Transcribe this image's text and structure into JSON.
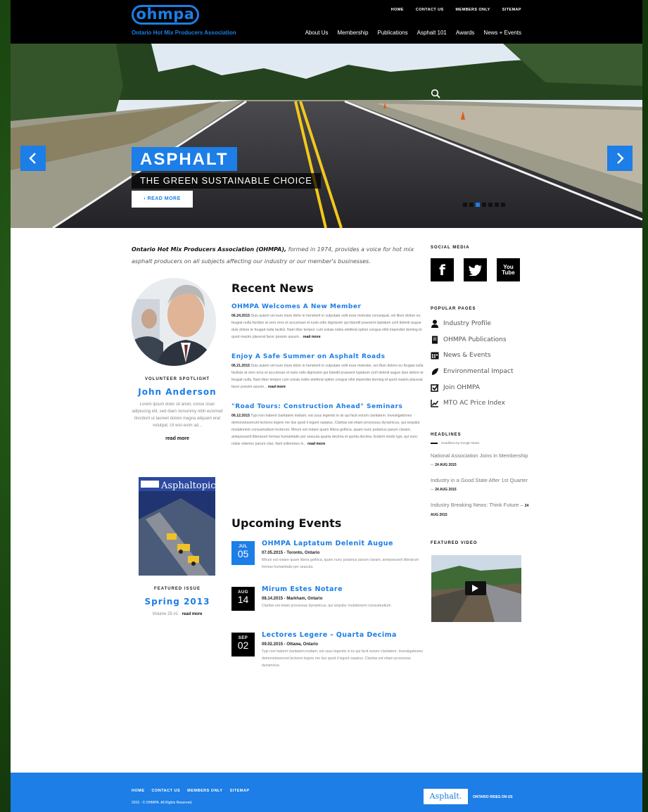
{
  "header": {
    "logo": "ohmpa",
    "logo_subtitle": "Ontario Hot Mix Producers Association",
    "utility_nav": [
      "HOME",
      "CONTACT US",
      "MEMBERS ONLY",
      "SITEMAP"
    ],
    "main_nav": [
      "About Us",
      "Membership",
      "Publications",
      "Asphalt 101",
      "Awards",
      "News + Events"
    ]
  },
  "hero": {
    "title": "ASPHALT",
    "subtitle": "THE GREEN SUSTAINABLE CHOICE",
    "button_label": "› READ MORE",
    "slide_count": 7,
    "active_slide": 3
  },
  "intro": {
    "org_name": "Ontario Hot Mix Producers Association (OHMPA),",
    "text": " formed in 1974, provides a voice for hot mix asphalt producers on all subjects affecting our industry or our member's businesses."
  },
  "spotlight": {
    "label": "VOLUNTEER SPOTLIGHT",
    "name": "John Anderson",
    "text": "Lorem ipsum dolor sit amet, conse ctuer adipiscing elit, sed diam nonummy nibh euismod tincidunt ut laoreet dolore magna aliquam erat volutpat. Ut wisi enim ad...",
    "read_more": "read more"
  },
  "featured_issue": {
    "magazine_title": "Asphaltopics",
    "label": "FEATURED ISSUE",
    "name": "Spring 2013",
    "volume": "Volume 25 #1 ·",
    "read_more": "read more"
  },
  "recent_news": {
    "heading": "Recent News",
    "items": [
      {
        "title": "OHMPA Welcomes A New Member",
        "date": "06.24.2015",
        "body": " Duis autem vel eum iriure dolor in hendrerit in vulputate velit esse molestie consequat, vel illum dolore eu feugiat nulla facilisis at vero eros et accumsan et iusto odio dignissim qui blandit praesent luptatum zzril delenit augue duis dolore te feugait nulla facilisi. Nam liber tempor cum soluta nobis eleifend option congue nihil imperdiet doming id quod mazim placerat facer possim assum...",
        "more": "read more"
      },
      {
        "title": "Enjoy A Safe Summer on Asphalt Roads",
        "date": "06.21.2015",
        "body": " Duis autem vel eum iriure dolor in hendrerit in vulputate velit esse molestie, vel illum dolore eu feugiat nulla facilisis at vero eros et accumsan et iusto odio dignissim qui blandit praesent luptatum zzril delenit augue duis dolore te feugait nulla. Nam liber tempor cum soluta nobis eleifend option congue nihil imperdiet doming id quod mazim placerat facer possim assum...",
        "more": "read more"
      },
      {
        "title": "\"Road Tours: Construction Ahead\" Seminars",
        "date": "06.12.2015",
        "body": " Typi non habent claritatem insitam; est usus legentis in iis qui facit eorum claritatem. Investigationes demonstraverunt lectores legere me lius quod ii legunt saepius. Claritas est etiam processus dynamicus, qui sequitur mutationem consuetudium lectorum. Mirum est notare quam littera gothica, quam nunc putamus parum claram, anteposuerit litterarum formas humanitatis per seacula quarta decima et quinta decima. Eodem modo typi, qui nunc nobis videntur parum clari, fiant sollemnes in...",
        "more": "read more"
      }
    ]
  },
  "upcoming_events": {
    "heading": "Upcoming Events",
    "items": [
      {
        "month": "JUL",
        "day": "05",
        "title": "OHMPA Laptatum Delenit Augue",
        "meta": "07.05.2015 - Toronto, Ontario",
        "desc": "Mirum est notare quam littera gothica, quam nunc putamus parum claram, anteposuerit litterarum formas humanitatis per seacula."
      },
      {
        "month": "AUG",
        "day": "14",
        "title": "Mirum Estes Notare",
        "meta": "08.14.2015 - Markham, Ontario",
        "desc": "Claritas est etiam processus dynamicus, qui sequitur mutationem consuetudium."
      },
      {
        "month": "SEP",
        "day": "02",
        "title": "Lectores Legere - Quarta Decima",
        "meta": "09.02.2015 - Ottawa, Ontario",
        "desc": "Typi non habent claritatem insitam; est usus legentis in iis qui facit eorum claritatem. Investigationes demonstraverunt lectores legere me lius quod ii legunt saepius. Claritas est etiam processus dynamicus."
      }
    ]
  },
  "sidebar": {
    "social_label": "SOCIAL MEDIA",
    "social": [
      {
        "icon": "facebook-icon",
        "glyph": "f"
      },
      {
        "icon": "twitter-icon",
        "glyph": "t"
      },
      {
        "icon": "youtube-icon",
        "glyph": "You Tube"
      }
    ],
    "popular_label": "POPULAR PAGES",
    "popular": [
      {
        "icon": "person-icon",
        "label": "Industry Profile"
      },
      {
        "icon": "document-icon",
        "label": "OHMPA Publications"
      },
      {
        "icon": "calendar-icon",
        "label": "News & Events"
      },
      {
        "icon": "leaf-icon",
        "label": "Environmental Impact"
      },
      {
        "icon": "checkbox-icon",
        "label": "Join OHMPA"
      },
      {
        "icon": "chart-icon",
        "label": "MTO AC Price Index"
      }
    ],
    "headlines_label": "HEADLINES",
    "headlines_source": "Headlines by Google News",
    "headlines": [
      {
        "text": "National Association Joins in Membership",
        "date": "24 AUG 2015"
      },
      {
        "text": "Industry in a Good State After 1st Quarter",
        "date": "24 AUG 2015"
      },
      {
        "text": "Industry Breaking News: Think Future",
        "date": "24 AUG 2015"
      }
    ],
    "video_label": "FEATURED VIDEO"
  },
  "footer": {
    "nav": [
      "HOME",
      "CONTACT US",
      "MEMBERS ONLY",
      "SITEMAP"
    ],
    "copyright": "2015 - © OHMPA. All Rights Reserved.",
    "asphalt_logo": "Asphalt.",
    "asphalt_sub": "ONTARIO RIDES ON US"
  },
  "colors": {
    "accent": "#1c7ee6",
    "header_bg": "#000000",
    "footer_bg": "#1c7ee6"
  }
}
